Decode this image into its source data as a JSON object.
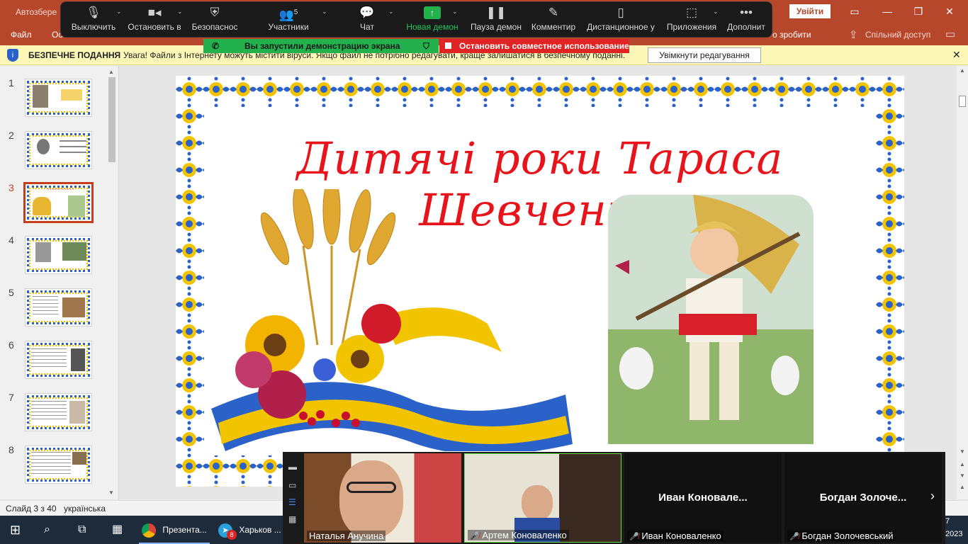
{
  "powerpoint": {
    "doc_title": "Автозбере",
    "signin": "Увійти",
    "file_tab": "Файл",
    "tab_partial": "Ос",
    "tellme": "о зробити",
    "share": "Спільний доступ"
  },
  "zoom_toolbar": {
    "items": [
      {
        "label": "Выключить"
      },
      {
        "label": "Остановить в"
      },
      {
        "label": "Безопаснос"
      },
      {
        "label": "Участники",
        "count": "5"
      },
      {
        "label": "Чат"
      },
      {
        "label": "Новая демон"
      },
      {
        "label": "Пауза демон"
      },
      {
        "label": "Комментир"
      },
      {
        "label": "Дистанционное у"
      },
      {
        "label": "Приложения"
      },
      {
        "label": "Дополнит"
      }
    ]
  },
  "sharing": {
    "started": "Вы запустили демонстрацию экрана",
    "stop": "Остановить совместное использование"
  },
  "protected_view": {
    "title": "БЕЗПЕЧНЕ ПОДАННЯ",
    "message": "Увага! Файли з Інтернету можуть містити віруси. Якщо файл не потрібно редагувати, краще залишатися в безпечному поданні.",
    "enable_button": "Увімкнути редагування"
  },
  "thumbnails": [
    {
      "num": "1"
    },
    {
      "num": "2"
    },
    {
      "num": "3"
    },
    {
      "num": "4"
    },
    {
      "num": "5"
    },
    {
      "num": "6"
    },
    {
      "num": "7"
    },
    {
      "num": "8"
    }
  ],
  "slide": {
    "title": "Дитячі роки Тараса Шевченка"
  },
  "status": {
    "slide_info": "Слайд 3 з 40",
    "language": "українська"
  },
  "taskbar": {
    "apps": [
      {
        "label": "Презента..."
      },
      {
        "label": "Харьков ...",
        "badge": "8"
      }
    ],
    "clock_partial": "7",
    "year_partial": "2023"
  },
  "participants": [
    {
      "name": "Наталья Анучина"
    },
    {
      "name": "Артем Коноваленко"
    },
    {
      "name": "Иван Коноваленко",
      "big": "Иван  Коновале..."
    },
    {
      "name": "Богдан Золочевський",
      "big": "Богдан  Золоче..."
    }
  ],
  "colors": {
    "pp_red": "#b7472a",
    "zoom_green": "#22b14c",
    "zoom_red": "#e02424",
    "title_red": "#e8141c",
    "ua_blue": "#2a62c9",
    "ua_yellow": "#f2c400"
  }
}
